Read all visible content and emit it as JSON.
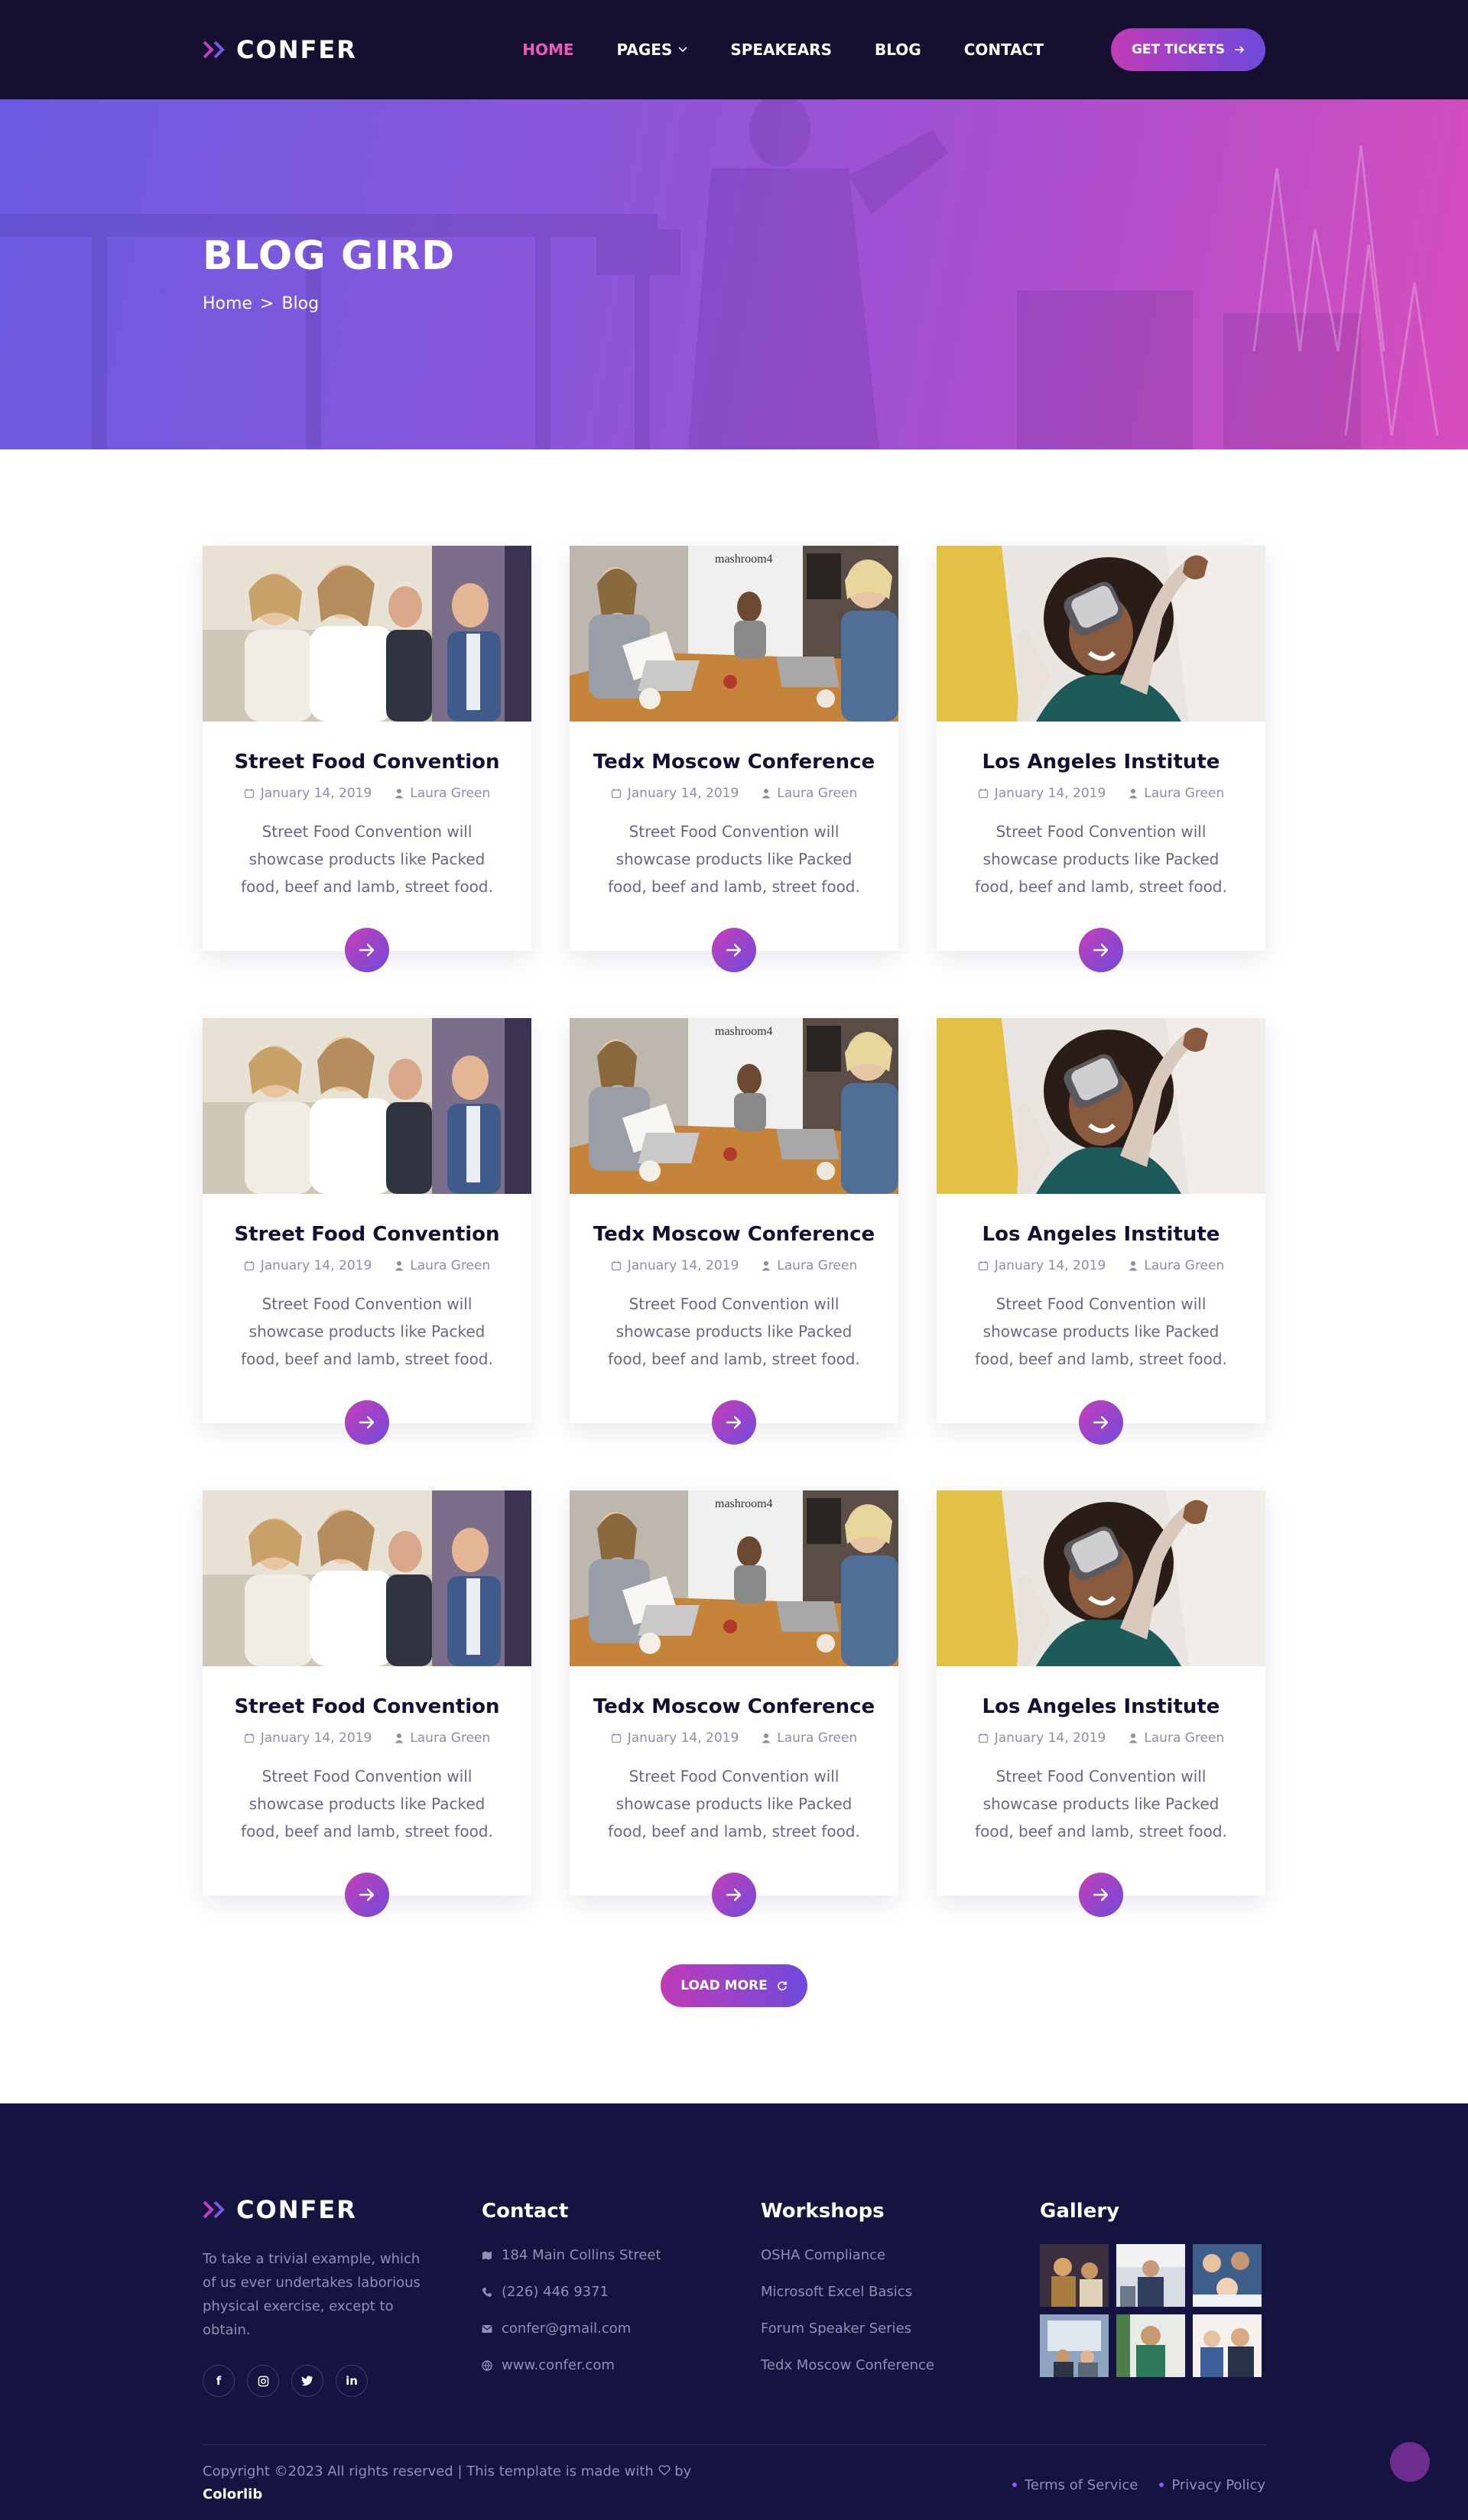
{
  "brand": {
    "name": "CONFER"
  },
  "nav": {
    "items": [
      {
        "label": "HOME",
        "active": true
      },
      {
        "label": "PAGES",
        "dropdown": true
      },
      {
        "label": "SPEAKEARS"
      },
      {
        "label": "BLOG"
      },
      {
        "label": "CONTACT"
      }
    ],
    "tickets_label": "GET TICKETS"
  },
  "hero": {
    "title": "BLOG GIRD",
    "breadcrumb": {
      "home": "Home",
      "separator": ">",
      "current": "Blog"
    }
  },
  "posts": [
    {
      "title": "Street Food Convention",
      "date": "January 14, 2019",
      "author": "Laura Green",
      "excerpt": "Street Food Convention will showcase products like Packed food, beef and lamb, street food.",
      "image": "meeting-audience"
    },
    {
      "title": "Tedx Moscow Conference",
      "date": "January 14, 2019",
      "author": "Laura Green",
      "excerpt": "Street Food Convention will showcase products like Packed food, beef and lamb, street food.",
      "image": "office-table"
    },
    {
      "title": "Los Angeles Institute",
      "date": "January 14, 2019",
      "author": "Laura Green",
      "excerpt": "Street Food Convention will showcase products like Packed food, beef and lamb, street food.",
      "image": "vr-woman"
    },
    {
      "title": "Street Food Convention",
      "date": "January 14, 2019",
      "author": "Laura Green",
      "excerpt": "Street Food Convention will showcase products like Packed food, beef and lamb, street food.",
      "image": "meeting-audience"
    },
    {
      "title": "Tedx Moscow Conference",
      "date": "January 14, 2019",
      "author": "Laura Green",
      "excerpt": "Street Food Convention will showcase products like Packed food, beef and lamb, street food.",
      "image": "office-table"
    },
    {
      "title": "Los Angeles Institute",
      "date": "January 14, 2019",
      "author": "Laura Green",
      "excerpt": "Street Food Convention will showcase products like Packed food, beef and lamb, street food.",
      "image": "vr-woman"
    },
    {
      "title": "Street Food Convention",
      "date": "January 14, 2019",
      "author": "Laura Green",
      "excerpt": "Street Food Convention will showcase products like Packed food, beef and lamb, street food.",
      "image": "meeting-audience"
    },
    {
      "title": "Tedx Moscow Conference",
      "date": "January 14, 2019",
      "author": "Laura Green",
      "excerpt": "Street Food Convention will showcase products like Packed food, beef and lamb, street food.",
      "image": "office-table"
    },
    {
      "title": "Los Angeles Institute",
      "date": "January 14, 2019",
      "author": "Laura Green",
      "excerpt": "Street Food Convention will showcase products like Packed food, beef and lamb, street food.",
      "image": "vr-woman"
    }
  ],
  "load_more_label": "LOAD MORE",
  "footer": {
    "about": "To take a trivial example, which of us ever undertakes laborious physical exercise, except to obtain.",
    "socials": [
      "f",
      "ig",
      "tw",
      "in"
    ],
    "contact": {
      "heading": "Contact",
      "address": "184 Main Collins Street",
      "phone": "(226) 446 9371",
      "email": "confer@gmail.com",
      "website": "www.confer.com"
    },
    "workshops": {
      "heading": "Workshops",
      "items": [
        "OSHA Compliance",
        "Microsoft Excel Basics",
        "Forum Speaker Series",
        "Tedx Moscow Conference"
      ]
    },
    "gallery": {
      "heading": "Gallery",
      "count": 6
    },
    "copyright": "Copyright ©2023 All rights reserved | This template is made with",
    "copyright_by": "by",
    "credit": "Colorlib",
    "legal": [
      "Terms of Service",
      "Privacy Policy"
    ]
  },
  "colors": {
    "accent_pink": "#ec5bb9",
    "accent_purple": "#6e4bdc",
    "header_bg": "#15102f",
    "footer_bg": "#15133f"
  }
}
